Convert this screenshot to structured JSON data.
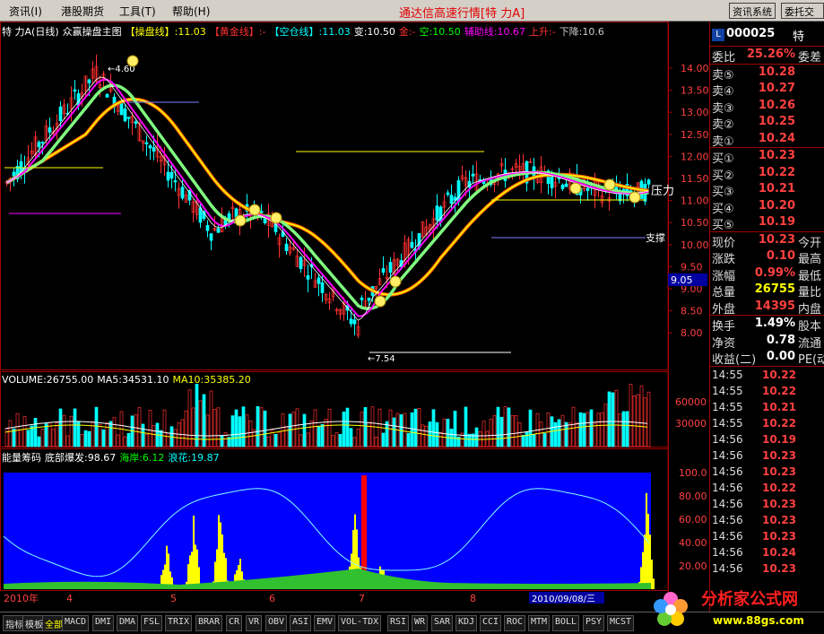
{
  "menu": {
    "items": [
      {
        "label": "资讯(I)"
      },
      {
        "label": "港股期货"
      },
      {
        "label": "工具(T)"
      },
      {
        "label": "帮助(H)"
      }
    ],
    "app_title": "通达信高速行情[特  力A]",
    "buttons": [
      {
        "label": "资讯系统"
      },
      {
        "label": "委托交易"
      }
    ]
  },
  "main_chart": {
    "header": {
      "stock": "特  力A(日线)",
      "formula": "众赢操盘主图",
      "items": [
        {
          "text": "【操盘线】:11.03",
          "color": "#ffff00"
        },
        {
          "text": "【黄金线】:-",
          "color": "#ff3030"
        },
        {
          "text": "【空仓线】:11.03",
          "color": "#00ffff"
        },
        {
          "text": "变:10.50",
          "color": "#ffffff"
        },
        {
          "text": "金:-",
          "color": "#ff3030"
        },
        {
          "text": "空:10.50",
          "color": "#00ff00"
        },
        {
          "text": "辅助线:10.67",
          "color": "#ff00ff"
        },
        {
          "text": "上升:-",
          "color": "#ff3030"
        },
        {
          "text": "下降:10.6",
          "color": "#cccccc"
        }
      ]
    },
    "y_ticks": [
      "14.00",
      "13.50",
      "13.00",
      "12.50",
      "12.00",
      "11.50",
      "11.00",
      "10.50",
      "10.00",
      "9.50",
      "9.00",
      "8.50",
      "8.00"
    ],
    "price_tag": "9.05",
    "annotations": {
      "high": "4.60",
      "low": "7.54",
      "pressure": "压力",
      "support": "支撑"
    }
  },
  "volume_panel": {
    "items": [
      {
        "text": "VOLUME:26755.00",
        "color": "#ffffff"
      },
      {
        "text": "MA5:34531.10",
        "color": "#ffffff"
      },
      {
        "text": "MA10:35385.20",
        "color": "#ffff00"
      }
    ],
    "y_ticks": [
      "60000",
      "30000"
    ]
  },
  "energy_panel": {
    "items": [
      {
        "text": "能量筹码",
        "color": "#ffffff"
      },
      {
        "text": "底部爆发:98.67",
        "color": "#ffffff"
      },
      {
        "text": "海岸:6.12",
        "color": "#00ff00"
      },
      {
        "text": "浪花:19.87",
        "color": "#00ffff"
      }
    ],
    "y_ticks": [
      "100.0",
      "80.00",
      "60.00",
      "40.00",
      "20.00"
    ]
  },
  "timeline": {
    "labels": [
      "2010年",
      "4",
      "5",
      "6",
      "7",
      "8",
      "9"
    ],
    "cursor_date": "2010/09/08/三"
  },
  "quote": {
    "code": "000025",
    "name": "特",
    "weibi": {
      "label": "委比",
      "value": "25.26%",
      "extra": "委差"
    },
    "sell": [
      {
        "label": "卖⑤",
        "price": "10.28"
      },
      {
        "label": "卖④",
        "price": "10.27"
      },
      {
        "label": "卖③",
        "price": "10.26"
      },
      {
        "label": "卖②",
        "price": "10.25"
      },
      {
        "label": "卖①",
        "price": "10.24"
      }
    ],
    "buy": [
      {
        "label": "买①",
        "price": "10.23"
      },
      {
        "label": "买②",
        "price": "10.22"
      },
      {
        "label": "买③",
        "price": "10.21"
      },
      {
        "label": "买④",
        "price": "10.20"
      },
      {
        "label": "买⑤",
        "price": "10.19"
      }
    ],
    "stats": [
      {
        "label": "现价",
        "value": "10.23",
        "extra": "今开",
        "color": "#ff4040"
      },
      {
        "label": "涨跌",
        "value": "0.10",
        "extra": "最高",
        "color": "#ff4040"
      },
      {
        "label": "涨幅",
        "value": "0.99%",
        "extra": "最低",
        "color": "#ff4040"
      },
      {
        "label": "总量",
        "value": "26755",
        "extra": "量比",
        "color": "#ffff00"
      },
      {
        "label": "外盘",
        "value": "14395",
        "extra": "内盘",
        "color": "#ff4040"
      }
    ],
    "fin": [
      {
        "label": "换手",
        "value": "1.49%",
        "extra": "股本",
        "color": "#ffffff"
      },
      {
        "label": "净资",
        "value": "0.78",
        "extra": "流通",
        "color": "#ffffff"
      },
      {
        "label": "收益(二)",
        "value": "0.00",
        "extra": "PE(动)",
        "color": "#ffffff"
      }
    ],
    "ticks": [
      {
        "time": "14:55",
        "price": "10.22"
      },
      {
        "time": "14:55",
        "price": "10.22"
      },
      {
        "time": "14:55",
        "price": "10.21"
      },
      {
        "time": "14:55",
        "price": "10.22"
      },
      {
        "time": "14:56",
        "price": "10.19"
      },
      {
        "time": "14:56",
        "price": "10.23"
      },
      {
        "time": "14:56",
        "price": "10.23"
      },
      {
        "time": "14:56",
        "price": "10.22"
      },
      {
        "time": "14:56",
        "price": "10.23"
      },
      {
        "time": "14:56",
        "price": "10.23"
      },
      {
        "time": "14:56",
        "price": "10.23"
      },
      {
        "time": "14:56",
        "price": "10.24"
      },
      {
        "time": "14:56",
        "price": "10.23"
      }
    ]
  },
  "tabs": [
    "指标",
    "模板",
    "全部",
    "MACD",
    "DMI",
    "DMA",
    "FSL",
    "TRIX",
    "BRAR",
    "CR",
    "VR",
    "OBV",
    "ASI",
    "EMV",
    "VOL-TDX",
    "RSI",
    "WR",
    "SAR",
    "KDJ",
    "CCI",
    "ROC",
    "MTM",
    "BOLL",
    "PSY",
    "MCST"
  ],
  "logo": {
    "text": "分析家公式网",
    "url": "www.88gs.com"
  }
}
